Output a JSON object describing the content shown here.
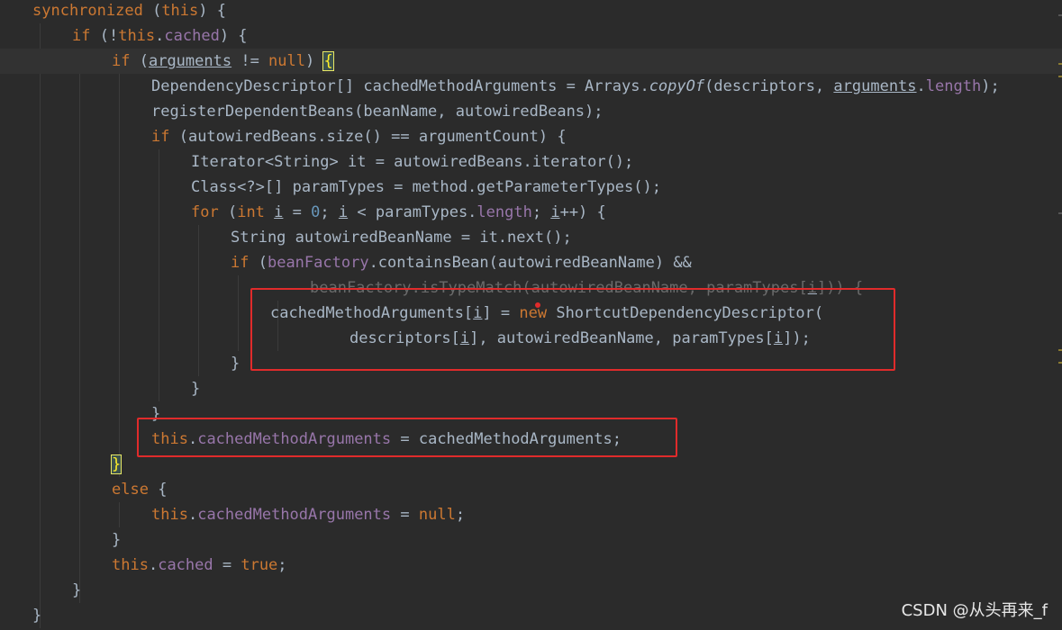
{
  "code_lines": [
    {
      "segments": [
        [
          "kw",
          "synchronized"
        ],
        [
          "",
          " ("
        ],
        [
          "kw",
          "this"
        ],
        [
          "",
          ") {"
        ]
      ]
    },
    {
      "segments": [
        [
          "kw",
          "if"
        ],
        [
          "",
          " (!"
        ],
        [
          "kw",
          "this"
        ],
        [
          "",
          "."
        ],
        [
          "field",
          "cached"
        ],
        [
          "",
          ") {"
        ]
      ]
    },
    {
      "segments": [
        [
          "kw",
          "if"
        ],
        [
          "",
          " ("
        ],
        [
          "ul",
          "arguments"
        ],
        [
          "",
          " != "
        ],
        [
          "kw",
          "null"
        ],
        [
          "",
          ") "
        ],
        [
          "brace",
          "{"
        ]
      ]
    },
    {
      "segments": [
        [
          "",
          "DependencyDescriptor[] cachedMethodArguments = Arrays."
        ],
        [
          "it",
          "copyOf"
        ],
        [
          "",
          "(descriptors, "
        ],
        [
          "ul",
          "arguments"
        ],
        [
          "",
          "."
        ],
        [
          "field",
          "length"
        ],
        [
          "",
          ");"
        ]
      ]
    },
    {
      "segments": [
        [
          "",
          "registerDependentBeans(beanName, autowiredBeans);"
        ]
      ]
    },
    {
      "segments": [
        [
          "kw",
          "if"
        ],
        [
          "",
          " (autowiredBeans.size() == argumentCount) {"
        ]
      ]
    },
    {
      "segments": [
        [
          "",
          "Iterator<String> it = autowiredBeans.iterator();"
        ]
      ]
    },
    {
      "segments": [
        [
          "",
          "Class<?>[] paramTypes = method.getParameterTypes();"
        ]
      ]
    },
    {
      "segments": [
        [
          "kw",
          "for"
        ],
        [
          "",
          " ("
        ],
        [
          "kw",
          "int"
        ],
        [
          "",
          " "
        ],
        [
          "ul",
          "i"
        ],
        [
          "",
          " = "
        ],
        [
          "num",
          "0"
        ],
        [
          "",
          "; "
        ],
        [
          "ul",
          "i"
        ],
        [
          "",
          " < paramTypes."
        ],
        [
          "field",
          "length"
        ],
        [
          "",
          "; "
        ],
        [
          "ul",
          "i"
        ],
        [
          "",
          "++) {"
        ]
      ]
    },
    {
      "segments": [
        [
          "",
          "String autowiredBeanName = it.next();"
        ]
      ]
    },
    {
      "segments": [
        [
          "kw",
          "if"
        ],
        [
          "",
          " ("
        ],
        [
          "field",
          "beanFactory"
        ],
        [
          "",
          ".containsBean(autowiredBeanName) &&"
        ]
      ]
    },
    {
      "segments": [
        [
          "field",
          "beanFactory"
        ],
        [
          "",
          ".isTypeMatch(autowiredBeanName, paramTypes["
        ],
        [
          "ul",
          "i"
        ],
        [
          "",
          "])) {"
        ]
      ]
    },
    {
      "segments": [
        [
          "",
          "cachedMethodArguments["
        ],
        [
          "ul",
          "i"
        ],
        [
          "",
          "] = "
        ],
        [
          "kw",
          "new"
        ],
        [
          "",
          " ShortcutDependencyDescriptor("
        ]
      ]
    },
    {
      "segments": [
        [
          "",
          "descriptors["
        ],
        [
          "ul",
          "i"
        ],
        [
          "",
          "], autowiredBeanName, paramTypes["
        ],
        [
          "ul",
          "i"
        ],
        [
          "",
          "]);"
        ]
      ]
    },
    {
      "segments": [
        [
          "",
          "}"
        ]
      ]
    },
    {
      "segments": [
        [
          "",
          "}"
        ]
      ]
    },
    {
      "segments": [
        [
          "",
          "}"
        ]
      ]
    },
    {
      "segments": [
        [
          "kw",
          "this"
        ],
        [
          "",
          "."
        ],
        [
          "field",
          "cachedMethodArguments"
        ],
        [
          "",
          " = cachedMethodArguments;"
        ]
      ]
    },
    {
      "segments": [
        [
          "brace",
          "}"
        ]
      ]
    },
    {
      "segments": [
        [
          "kw",
          "else"
        ],
        [
          "",
          " {"
        ]
      ]
    },
    {
      "segments": [
        [
          "kw",
          "this"
        ],
        [
          "",
          "."
        ],
        [
          "field",
          "cachedMethodArguments"
        ],
        [
          "",
          " = "
        ],
        [
          "kw",
          "null"
        ],
        [
          "",
          ";"
        ]
      ]
    },
    {
      "segments": [
        [
          "",
          "}"
        ]
      ]
    },
    {
      "segments": [
        [
          "kw",
          "this"
        ],
        [
          "",
          "."
        ],
        [
          "field",
          "cached"
        ],
        [
          "",
          " = "
        ],
        [
          "kw",
          "true"
        ],
        [
          "",
          ";"
        ]
      ]
    },
    {
      "segments": [
        [
          "",
          "}"
        ]
      ]
    },
    {
      "segments": [
        [
          "",
          "}"
        ]
      ]
    }
  ],
  "watermark": "CSDN @从头再来_f",
  "colors": {
    "background": "#2b2b2b",
    "keyword": "#cc7832",
    "field": "#9876aa",
    "number": "#6897bb",
    "text": "#a9b7c6",
    "highlight_box": "#e02b2b"
  }
}
